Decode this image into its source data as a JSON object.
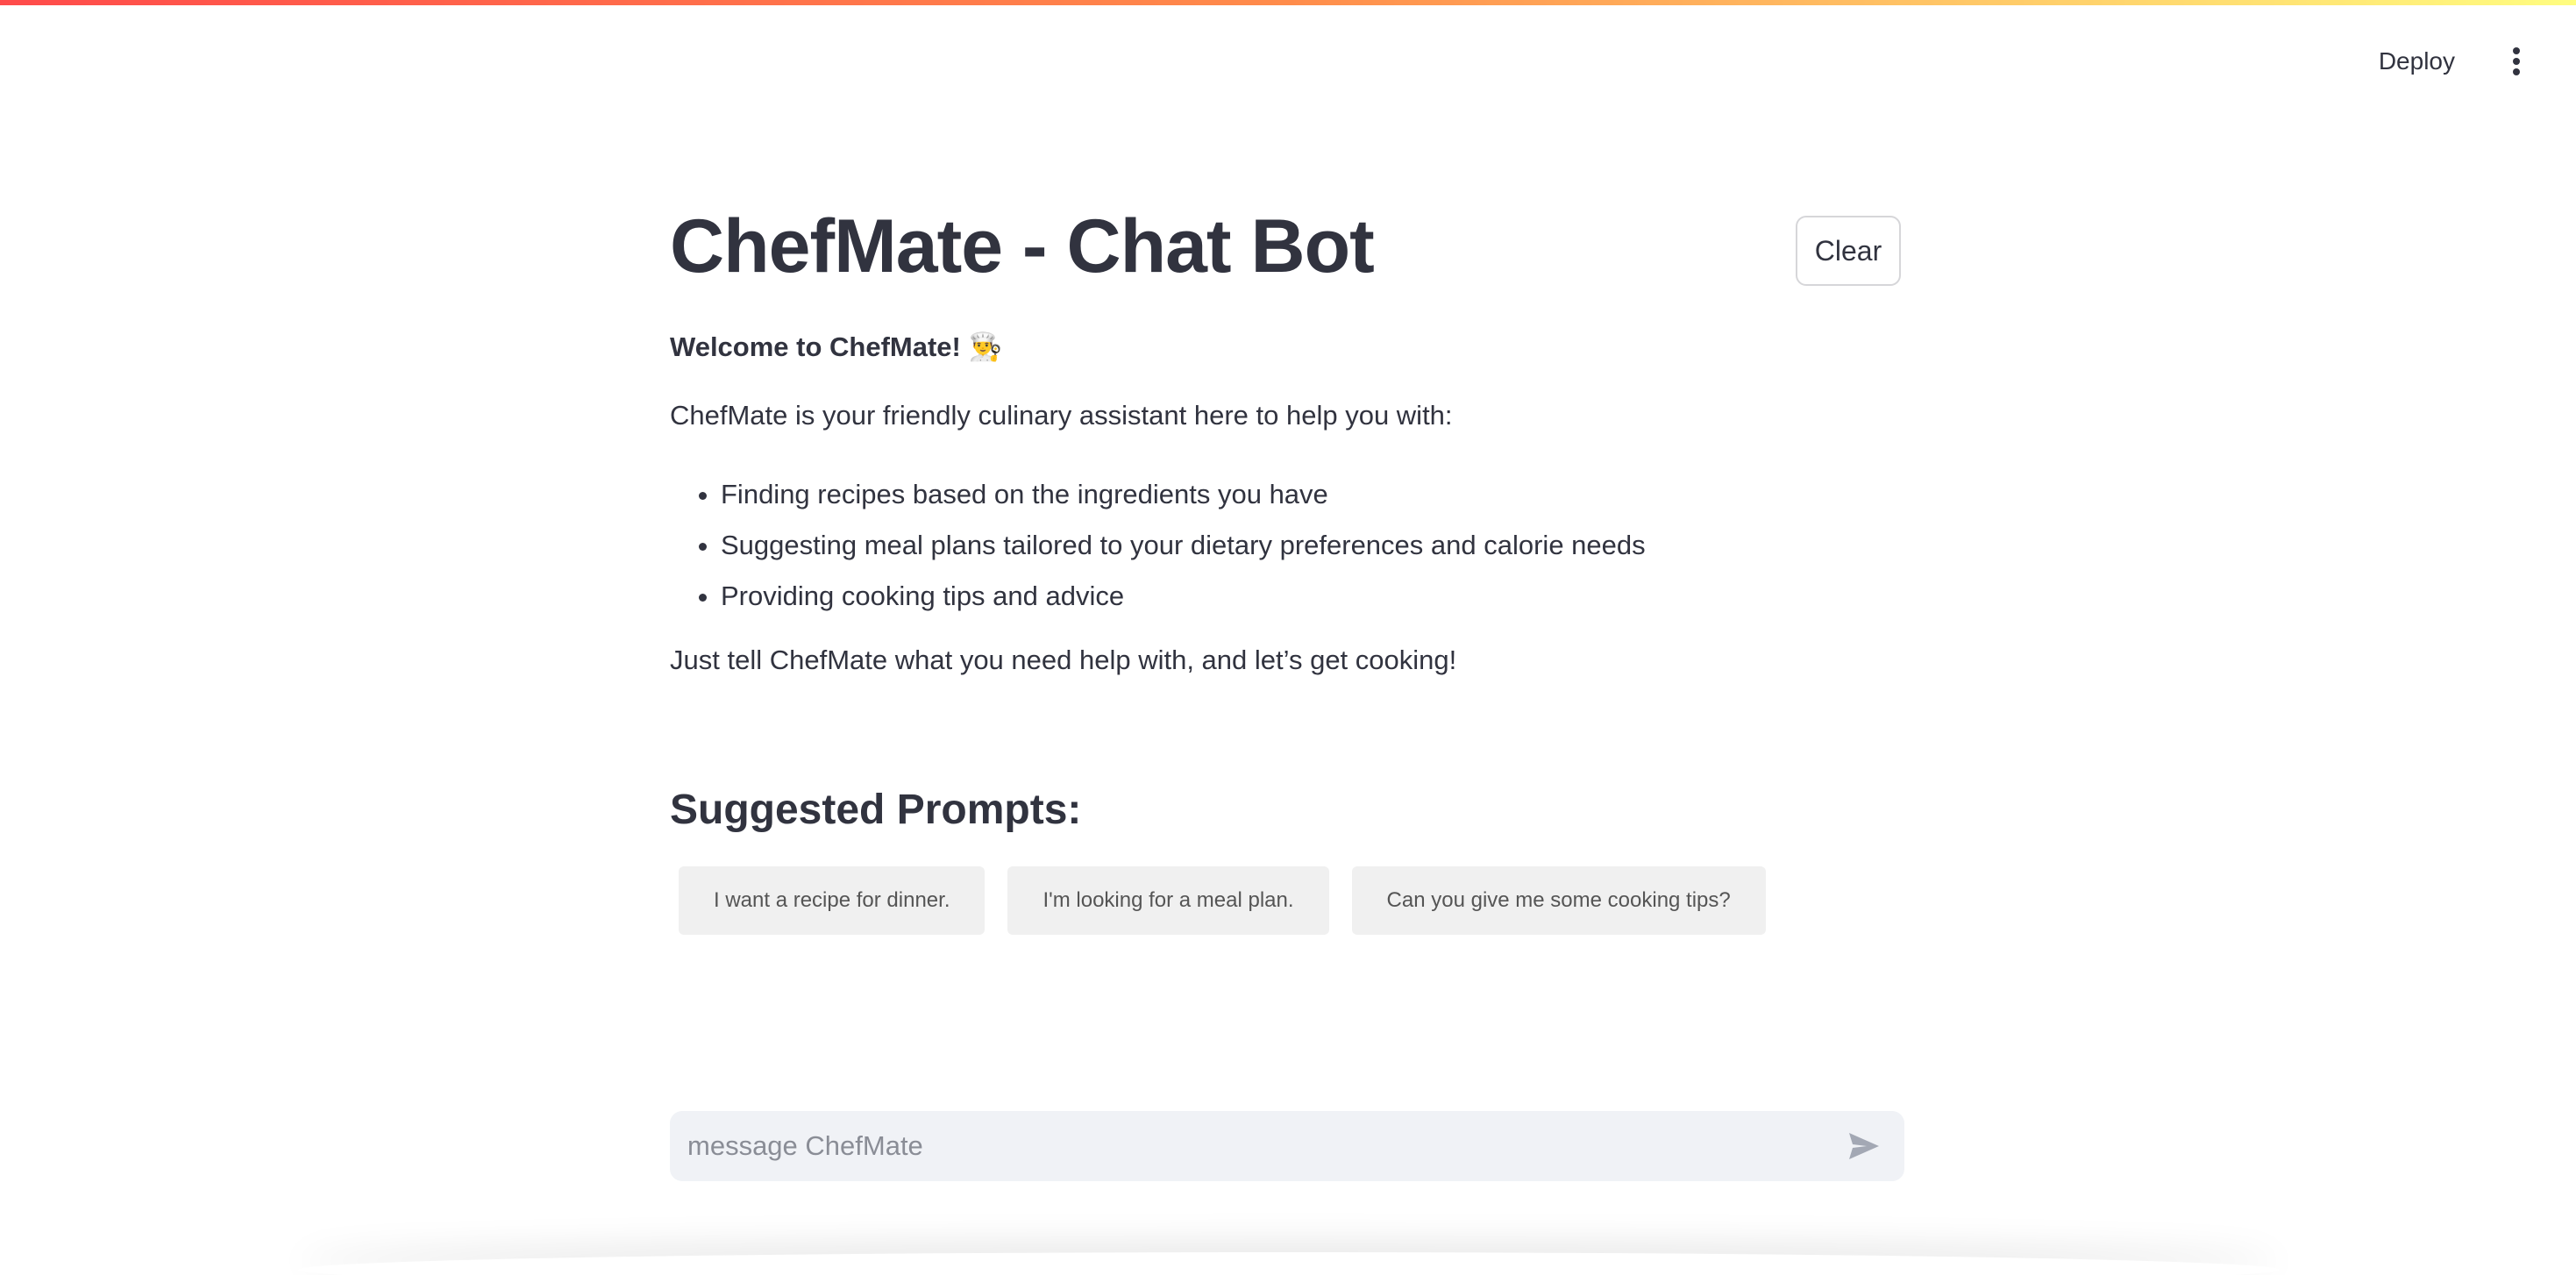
{
  "header": {
    "deploy_label": "Deploy",
    "menu_icon": "vertical-ellipsis-icon"
  },
  "main": {
    "title": "ChefMate - Chat Bot",
    "clear_label": "Clear",
    "welcome": "Welcome to ChefMate! 👨‍🍳",
    "intro": "ChefMate is your friendly culinary assistant here to help you with:",
    "features": [
      "Finding recipes based on the ingredients you have",
      "Suggesting meal plans tailored to your dietary preferences and calorie needs",
      "Providing cooking tips and advice"
    ],
    "closing": "Just tell ChefMate what you need help with, and let’s get cooking!"
  },
  "suggested": {
    "heading": "Suggested Prompts:",
    "prompts": [
      "I want a recipe for dinner.",
      "I'm looking for a meal plan.",
      "Can you give me some cooking tips?"
    ]
  },
  "chat": {
    "placeholder": "message ChefMate",
    "value": "",
    "send_icon": "send-icon"
  },
  "colors": {
    "text": "#31333f",
    "input_bg": "#f0f2f6",
    "prompt_bg": "#f0f0f0",
    "stripe_start": "#ff4b4b",
    "stripe_end": "#fffd80"
  }
}
